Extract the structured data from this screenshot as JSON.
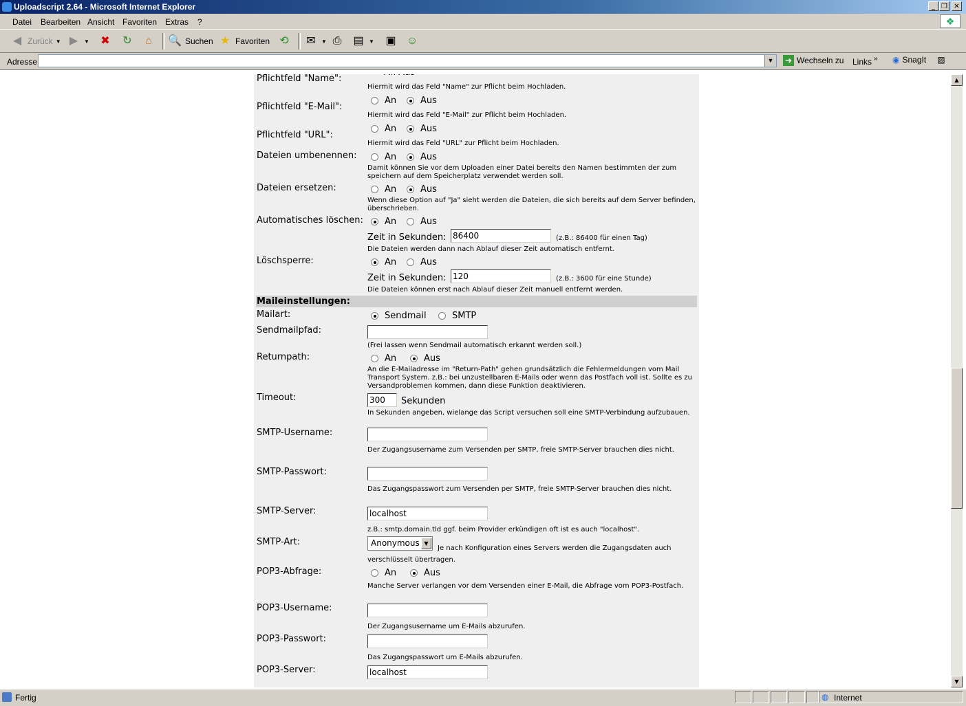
{
  "window": {
    "title": "Uploadscript 2.64 - Microsoft Internet Explorer"
  },
  "menu": [
    "Datei",
    "Bearbeiten",
    "Ansicht",
    "Favoriten",
    "Extras",
    "?"
  ],
  "toolbar": {
    "back": "Zurück",
    "search": "Suchen",
    "favorites": "Favoriten"
  },
  "address": {
    "label": "Adresse",
    "value": "",
    "go": "Wechseln zu",
    "links": "Links",
    "snagit": "SnagIt"
  },
  "radio": {
    "on": "An",
    "off": "Aus"
  },
  "partial_top": "An    Aus",
  "settings": [
    {
      "label": "Pflichtfeld \"Name\":",
      "desc": "Hiermit wird das Feld \"Name\" zur Pflicht beim Hochladen."
    },
    {
      "label": "Pflichtfeld \"E-Mail\":",
      "desc": "Hiermit wird das Feld \"E-Mail\" zur Pflicht beim Hochladen."
    },
    {
      "label": "Pflichtfeld \"URL\":",
      "desc": "Hiermit wird das Feld \"URL\" zur Pflicht beim Hochladen."
    },
    {
      "label": "Dateien umbenennen:",
      "desc": "Damit können Sie vor dem Uploaden einer Datei bereits den Namen bestimmten der zum speichern auf dem Speicherplatz verwendet werden soll."
    },
    {
      "label": "Dateien ersetzen:",
      "desc": "Wenn diese Option auf \"Ja\" sieht werden die Dateien, die sich bereits auf dem Server befinden, überschrieben."
    },
    {
      "label": "Automatisches löschen:",
      "time_label": "Zeit in Sekunden:",
      "time_value": "86400",
      "hint": "(z.B.: 86400 für einen Tag)",
      "desc": "Die Dateien werden dann nach Ablauf dieser Zeit automatisch entfernt."
    },
    {
      "label": "Löschsperre:",
      "time_label": "Zeit in Sekunden:",
      "time_value": "120",
      "hint": "(z.B.: 3600 für eine Stunde)",
      "desc": "Die Dateien können erst nach Ablauf dieser Zeit manuell entfernt werden."
    }
  ],
  "mail": {
    "section": "Maileinstellungen:",
    "mailart": {
      "label": "Mailart:",
      "opt1": "Sendmail",
      "opt2": "SMTP"
    },
    "sendmailpfad": {
      "label": "Sendmailpfad:",
      "value": "",
      "desc": "(Frei lassen wenn Sendmail automatisch erkannt werden soll.)"
    },
    "returnpath": {
      "label": "Returnpath:",
      "desc": "An die E-Mailadresse im \"Return-Path\" gehen grundsätzlich die Fehlermeldungen vom Mail Transport System. z.B.: bei unzustellbaren E-Mails oder wenn das Postfach voll ist. Sollte es zu Versandproblemen kommen, dann diese Funktion deaktivieren."
    },
    "timeout": {
      "label": "Timeout:",
      "value": "300",
      "unit": "Sekunden",
      "desc": "In Sekunden angeben, wielange das Script versuchen soll eine SMTP-Verbindung aufzubauen."
    },
    "smtp_user": {
      "label": "SMTP-Username:",
      "value": "",
      "desc": "Der Zugangsusername zum Versenden per SMTP, freie SMTP-Server brauchen dies nicht."
    },
    "smtp_pass": {
      "label": "SMTP-Passwort:",
      "value": "",
      "desc": "Das Zugangspasswort zum Versenden per SMTP, freie SMTP-Server brauchen dies nicht."
    },
    "smtp_server": {
      "label": "SMTP-Server:",
      "value": "localhost",
      "desc": "z.B.: smtp.domain.tld ggf. beim Provider erkündigen oft ist es auch \"localhost\"."
    },
    "smtp_art": {
      "label": "SMTP-Art:",
      "value": "Anonymous",
      "desc": "Je nach Konfiguration eines Servers werden die Zugangsdaten auch verschlüsselt übertragen."
    },
    "pop3": {
      "label": "POP3-Abfrage:",
      "desc": "Manche Server verlangen vor dem Versenden einer E-Mail, die Abfrage vom POP3-Postfach."
    },
    "pop3_user": {
      "label": "POP3-Username:",
      "value": "",
      "desc": "Der Zugangsusername um E-Mails abzurufen."
    },
    "pop3_pass": {
      "label": "POP3-Passwort:",
      "value": "",
      "desc": "Das Zugangspasswort um E-Mails abzurufen."
    },
    "pop3_server": {
      "label": "POP3-Server:",
      "value": "localhost"
    }
  },
  "status": {
    "text": "Fertig",
    "zone": "Internet"
  }
}
